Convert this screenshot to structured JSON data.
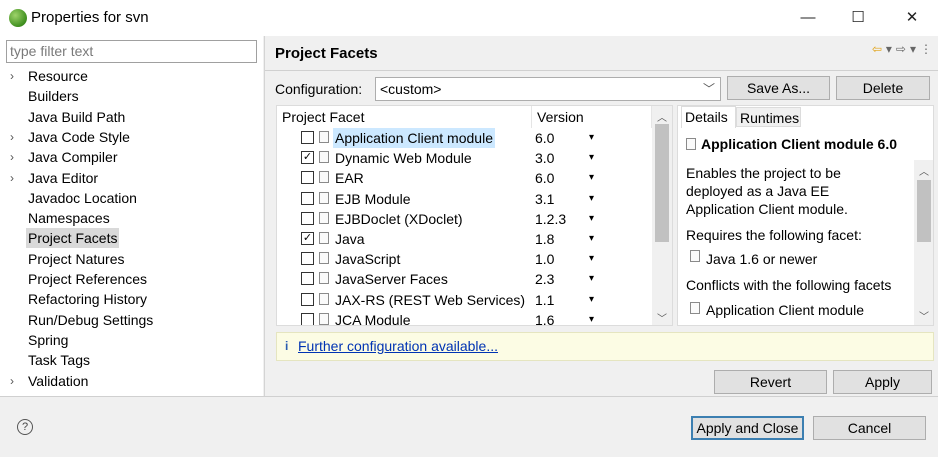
{
  "window": {
    "title": "Properties for svn",
    "minimize": "—",
    "maximize": "☐",
    "close": "✕"
  },
  "sidebar": {
    "filter_placeholder": "type filter text",
    "items": [
      {
        "label": "Resource",
        "expandable": true
      },
      {
        "label": "Builders",
        "expandable": false
      },
      {
        "label": "Java Build Path",
        "expandable": false
      },
      {
        "label": "Java Code Style",
        "expandable": true
      },
      {
        "label": "Java Compiler",
        "expandable": true
      },
      {
        "label": "Java Editor",
        "expandable": true
      },
      {
        "label": "Javadoc Location",
        "expandable": false
      },
      {
        "label": "Namespaces",
        "expandable": false
      },
      {
        "label": "Project Facets",
        "expandable": false,
        "selected": true
      },
      {
        "label": "Project Natures",
        "expandable": false
      },
      {
        "label": "Project References",
        "expandable": false
      },
      {
        "label": "Refactoring History",
        "expandable": false
      },
      {
        "label": "Run/Debug Settings",
        "expandable": false
      },
      {
        "label": "Spring",
        "expandable": false
      },
      {
        "label": "Task Tags",
        "expandable": false
      },
      {
        "label": "Validation",
        "expandable": true
      }
    ]
  },
  "main": {
    "title": "Project Facets",
    "configuration_label": "Configuration:",
    "configuration_value": "<custom>",
    "save_as_label": "Save As...",
    "delete_label": "Delete",
    "table": {
      "col_facet": "Project Facet",
      "col_version": "Version",
      "rows": [
        {
          "name": "Application Client module",
          "version": "6.0",
          "checked": false,
          "highlighted": true
        },
        {
          "name": "Dynamic Web Module",
          "version": "3.0",
          "checked": true
        },
        {
          "name": "EAR",
          "version": "6.0",
          "checked": false
        },
        {
          "name": "EJB Module",
          "version": "3.1",
          "checked": false
        },
        {
          "name": "EJBDoclet (XDoclet)",
          "version": "1.2.3",
          "checked": false
        },
        {
          "name": "Java",
          "version": "1.8",
          "checked": true
        },
        {
          "name": "JavaScript",
          "version": "1.0",
          "checked": false
        },
        {
          "name": "JavaServer Faces",
          "version": "2.3",
          "checked": false
        },
        {
          "name": "JAX-RS (REST Web Services)",
          "version": "1.1",
          "checked": false
        },
        {
          "name": "JCA Module",
          "version": "1.6",
          "checked": false
        }
      ]
    },
    "details": {
      "tab_details": "Details",
      "tab_runtimes": "Runtimes",
      "heading": "Application Client module 6.0",
      "desc_line1": "Enables the project to be",
      "desc_line2": "deployed as a Java EE",
      "desc_line3": "Application Client module.",
      "requires_label": "Requires the following facet:",
      "requires_item": "Java 1.6 or newer",
      "conflicts_label": "Conflicts with the following facets",
      "conflicts_item": "Application Client module"
    },
    "info_link": "Further configuration available...",
    "revert_label": "Revert",
    "apply_label": "Apply"
  },
  "footer": {
    "apply_close_label": "Apply and Close",
    "cancel_label": "Cancel"
  }
}
